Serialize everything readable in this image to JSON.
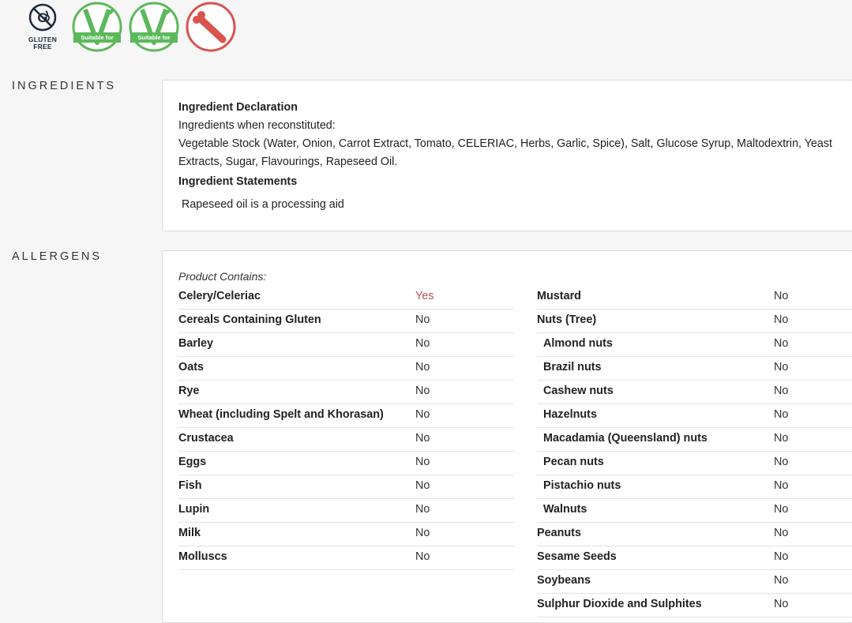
{
  "badges": {
    "gluten_free_label": "GLUTEN FREE",
    "vegetarian_label": "Suitable for",
    "vegan_label": "Suitable for",
    "colors": {
      "green": "#5cb85c",
      "red": "#d9534f",
      "navy": "#1d2b3a"
    },
    "icons": [
      "gluten-free-icon",
      "vegetarian-icon",
      "vegan-icon",
      "no-meat-icon"
    ]
  },
  "ingredients": {
    "section_title": "INGREDIENTS",
    "declaration_heading": "Ingredient Declaration",
    "reconstituted_label": "Ingredients when reconstituted:",
    "list_text": "Vegetable Stock (Water, Onion, Carrot Extract, Tomato, CELERIAC, Herbs, Garlic, Spice), Salt, Glucose Syrup, Maltodextrin, Yeast Extracts, Sugar, Flavourings, Rapeseed Oil.",
    "statements_heading": "Ingredient Statements",
    "statement_text": "Rapeseed oil is a processing aid"
  },
  "allergens": {
    "section_title": "ALLERGENS",
    "contains_label": "Product Contains:",
    "left": [
      {
        "name": "Celery/Celeriac",
        "value": "Yes"
      },
      {
        "name": "Cereals Containing Gluten",
        "value": "No"
      },
      {
        "name": "Barley",
        "value": "No"
      },
      {
        "name": "Oats",
        "value": "No"
      },
      {
        "name": "Rye",
        "value": "No"
      },
      {
        "name": "Wheat (including Spelt and Khorasan)",
        "value": "No"
      },
      {
        "name": "Crustacea",
        "value": "No"
      },
      {
        "name": "Eggs",
        "value": "No"
      },
      {
        "name": "Fish",
        "value": "No"
      },
      {
        "name": "Lupin",
        "value": "No"
      },
      {
        "name": "Milk",
        "value": "No"
      },
      {
        "name": "Molluscs",
        "value": "No"
      }
    ],
    "right": [
      {
        "name": "Mustard",
        "value": "No"
      },
      {
        "name": "Nuts (Tree)",
        "value": "No"
      },
      {
        "name": "Almond nuts",
        "value": "No"
      },
      {
        "name": "Brazil nuts",
        "value": "No"
      },
      {
        "name": "Cashew nuts",
        "value": "No"
      },
      {
        "name": "Hazelnuts",
        "value": "No"
      },
      {
        "name": "Macadamia (Queensland) nuts",
        "value": "No"
      },
      {
        "name": "Pecan nuts",
        "value": "No"
      },
      {
        "name": "Pistachio nuts",
        "value": "No"
      },
      {
        "name": "Walnuts",
        "value": "No"
      },
      {
        "name": "Peanuts",
        "value": "No"
      },
      {
        "name": "Sesame Seeds",
        "value": "No"
      },
      {
        "name": "Soybeans",
        "value": "No"
      },
      {
        "name": "Sulphur Dioxide and Sulphites",
        "value": "No"
      }
    ]
  }
}
